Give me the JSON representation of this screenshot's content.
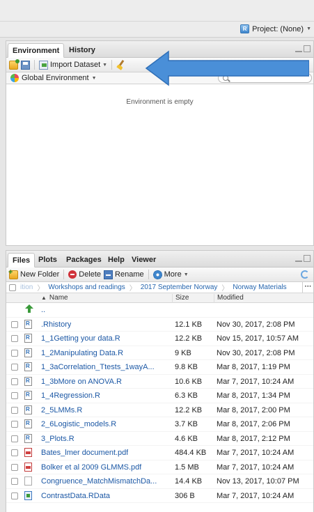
{
  "header": {
    "project_label": "Project: (None)"
  },
  "env_pane": {
    "tabs": [
      "Environment",
      "History"
    ],
    "toolbar": {
      "import_label": "Import Dataset"
    },
    "scope_label": "Global Environment",
    "empty_message": "Environment is empty"
  },
  "files_pane": {
    "tabs": [
      "Files",
      "Plots",
      "Packages",
      "Help",
      "Viewer"
    ],
    "toolbar": {
      "new_folder": "New Folder",
      "delete": "Delete",
      "rename": "Rename",
      "more": "More"
    },
    "breadcrumb": [
      "ition",
      "Workshops and readings",
      "2017 September Norway",
      "Norway Materials"
    ],
    "columns": {
      "name": "Name",
      "size": "Size",
      "modified": "Modified"
    },
    "up_label": "..",
    "files": [
      {
        "name": ".Rhistory",
        "size": "12.1 KB",
        "modified": "Nov 30, 2017, 2:08 PM",
        "icon": "r-script-icon"
      },
      {
        "name": "1_1Getting your data.R",
        "size": "12.2 KB",
        "modified": "Nov 15, 2017, 10:57 AM",
        "icon": "r-script-icon"
      },
      {
        "name": "1_2Manipulating Data.R",
        "size": "9 KB",
        "modified": "Nov 30, 2017, 2:08 PM",
        "icon": "r-script-icon"
      },
      {
        "name": "1_3aCorrelation_Ttests_1wayA...",
        "size": "9.8 KB",
        "modified": "Mar 8, 2017, 1:19 PM",
        "icon": "r-script-icon"
      },
      {
        "name": "1_3bMore on ANOVA.R",
        "size": "10.6 KB",
        "modified": "Mar 7, 2017, 10:24 AM",
        "icon": "r-script-icon"
      },
      {
        "name": "1_4Regression.R",
        "size": "6.3 KB",
        "modified": "Mar 8, 2017, 1:34 PM",
        "icon": "r-script-icon"
      },
      {
        "name": "2_5LMMs.R",
        "size": "12.2 KB",
        "modified": "Mar 8, 2017, 2:00 PM",
        "icon": "r-script-icon"
      },
      {
        "name": "2_6Logistic_models.R",
        "size": "3.7 KB",
        "modified": "Mar 8, 2017, 2:06 PM",
        "icon": "r-script-icon"
      },
      {
        "name": "3_Plots.R",
        "size": "4.6 KB",
        "modified": "Mar 8, 2017, 2:12 PM",
        "icon": "r-script-icon"
      },
      {
        "name": "Bates_lmer document.pdf",
        "size": "484.4 KB",
        "modified": "Mar 7, 2017, 10:24 AM",
        "icon": "pdf-icon"
      },
      {
        "name": "Bolker et al 2009 GLMMS.pdf",
        "size": "1.5 MB",
        "modified": "Mar 7, 2017, 10:24 AM",
        "icon": "pdf-icon"
      },
      {
        "name": "Congruence_MatchMismatchDa...",
        "size": "14.4 KB",
        "modified": "Nov 13, 2017, 10:07 PM",
        "icon": "file-icon"
      },
      {
        "name": "ContrastData.RData",
        "size": "306 B",
        "modified": "Mar 7, 2017, 10:24 AM",
        "icon": "rdata-icon"
      }
    ]
  },
  "colors": {
    "link": "#1c58a5",
    "annotation_arrow": "#4a8fd8"
  }
}
